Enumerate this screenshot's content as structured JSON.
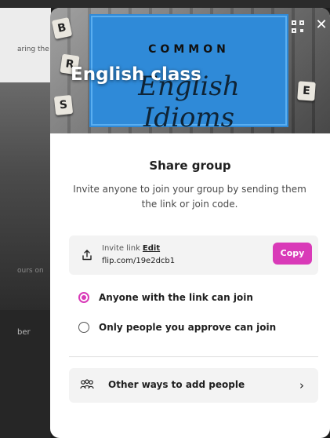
{
  "background": {
    "text_1": "aring the",
    "text_2": "ours on",
    "text_3": "ber"
  },
  "hero": {
    "group_name": "English class",
    "book_heading": "COMMON",
    "book_script": "English Idioms",
    "tiles": [
      "B",
      "R",
      "S",
      "E"
    ],
    "qr_icon": "qr-code-icon",
    "close_icon": "close-icon"
  },
  "share": {
    "title": "Share group",
    "description": "Invite anyone to join your group by sending them the link or join code."
  },
  "invite": {
    "label": "Invite link",
    "edit_label": "Edit",
    "url": "flip.com/19e2dcb1",
    "copy_label": "Copy",
    "icon": "share-upload-icon"
  },
  "join_options": [
    {
      "label": "Anyone with the link can join",
      "selected": true
    },
    {
      "label": "Only people you approve can join",
      "selected": false
    }
  ],
  "other_ways": {
    "label": "Other ways to add people",
    "icon": "people-group-icon",
    "chevron": "›"
  },
  "colors": {
    "accent": "#d93ab8",
    "panel_bg": "#f3f3f3",
    "book_blue": "#2f8ad8"
  }
}
